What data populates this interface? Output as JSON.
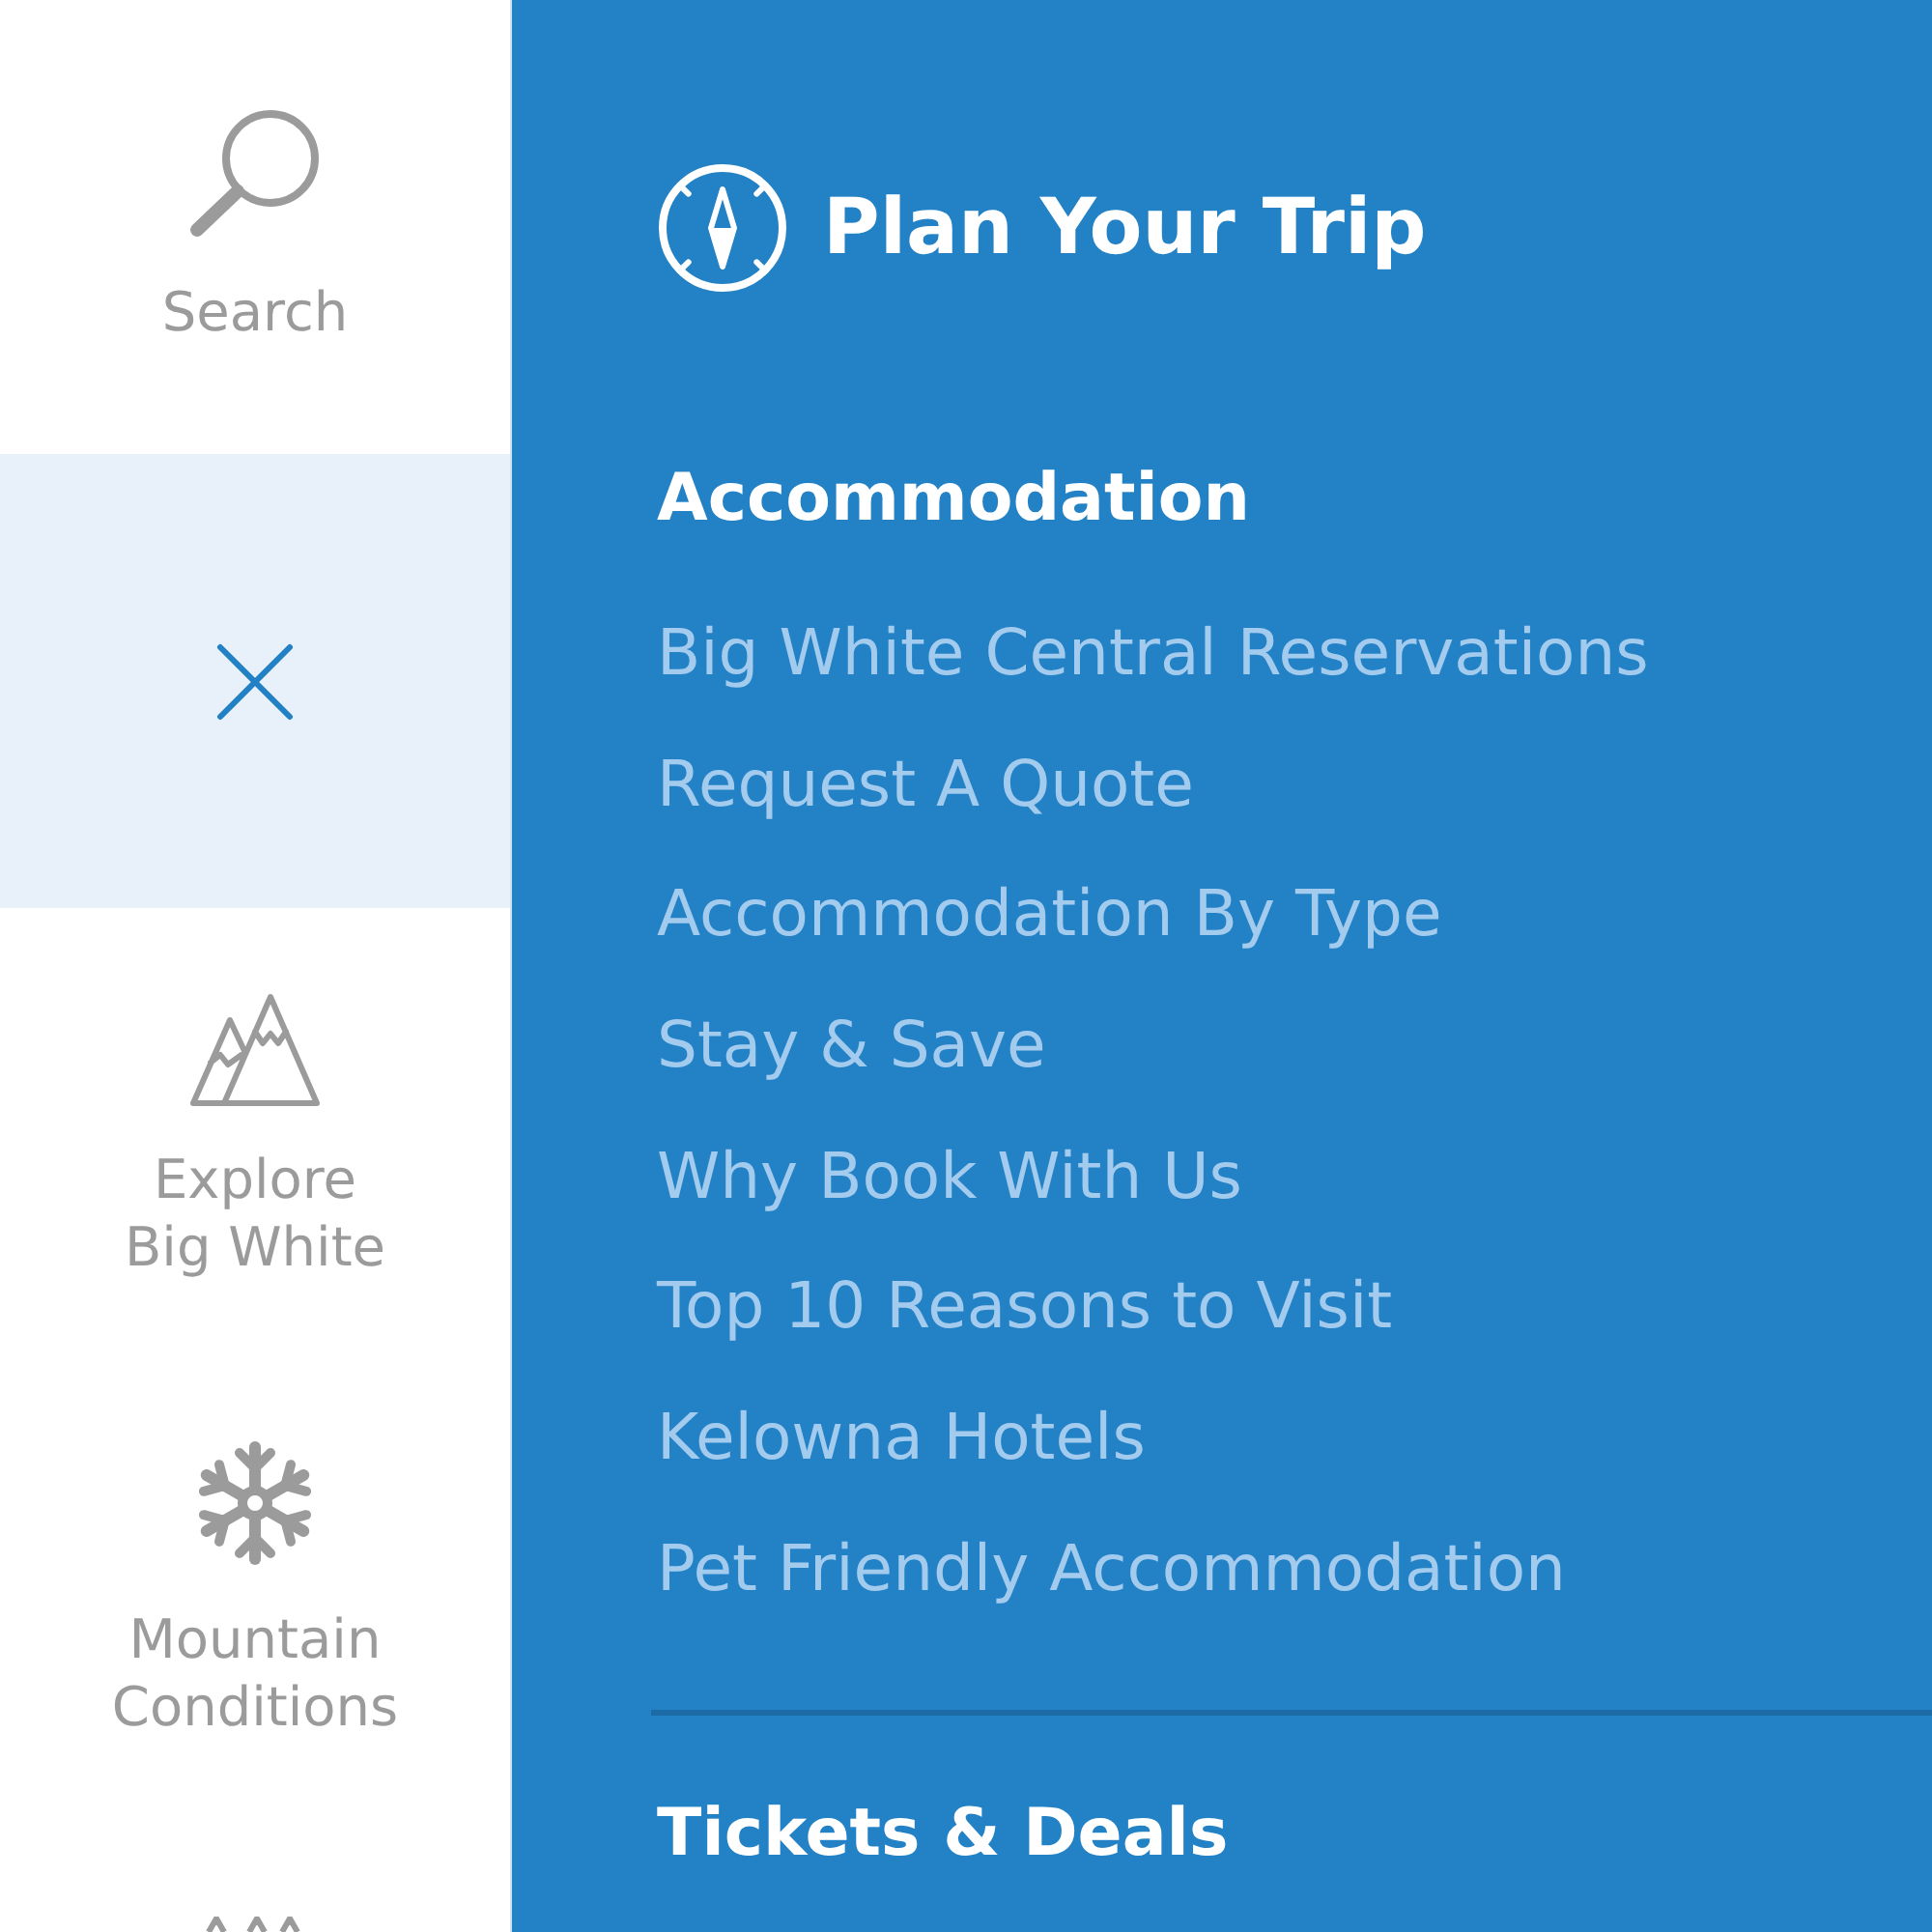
{
  "sidebar": {
    "items": [
      {
        "kind": "search",
        "label": "Search",
        "selected": false
      },
      {
        "kind": "close",
        "selected": true
      },
      {
        "kind": "mountains",
        "label": "Explore\nBig White",
        "selected": false
      },
      {
        "kind": "snowflake",
        "label": "Mountain\nConditions",
        "selected": false
      },
      {
        "kind": "partial",
        "selected": false
      }
    ]
  },
  "panel": {
    "title": "Plan Your Trip",
    "sections": [
      {
        "heading": "Accommodation",
        "links": [
          "Big White Central Reservations",
          "Request A Quote",
          "Accommodation By Type",
          "Stay & Save",
          "Why Book With Us",
          "Top 10 Reasons to Visit",
          "Kelowna Hotels",
          "Pet Friendly Accommodation"
        ]
      },
      {
        "heading": "Tickets & Deals"
      }
    ]
  }
}
